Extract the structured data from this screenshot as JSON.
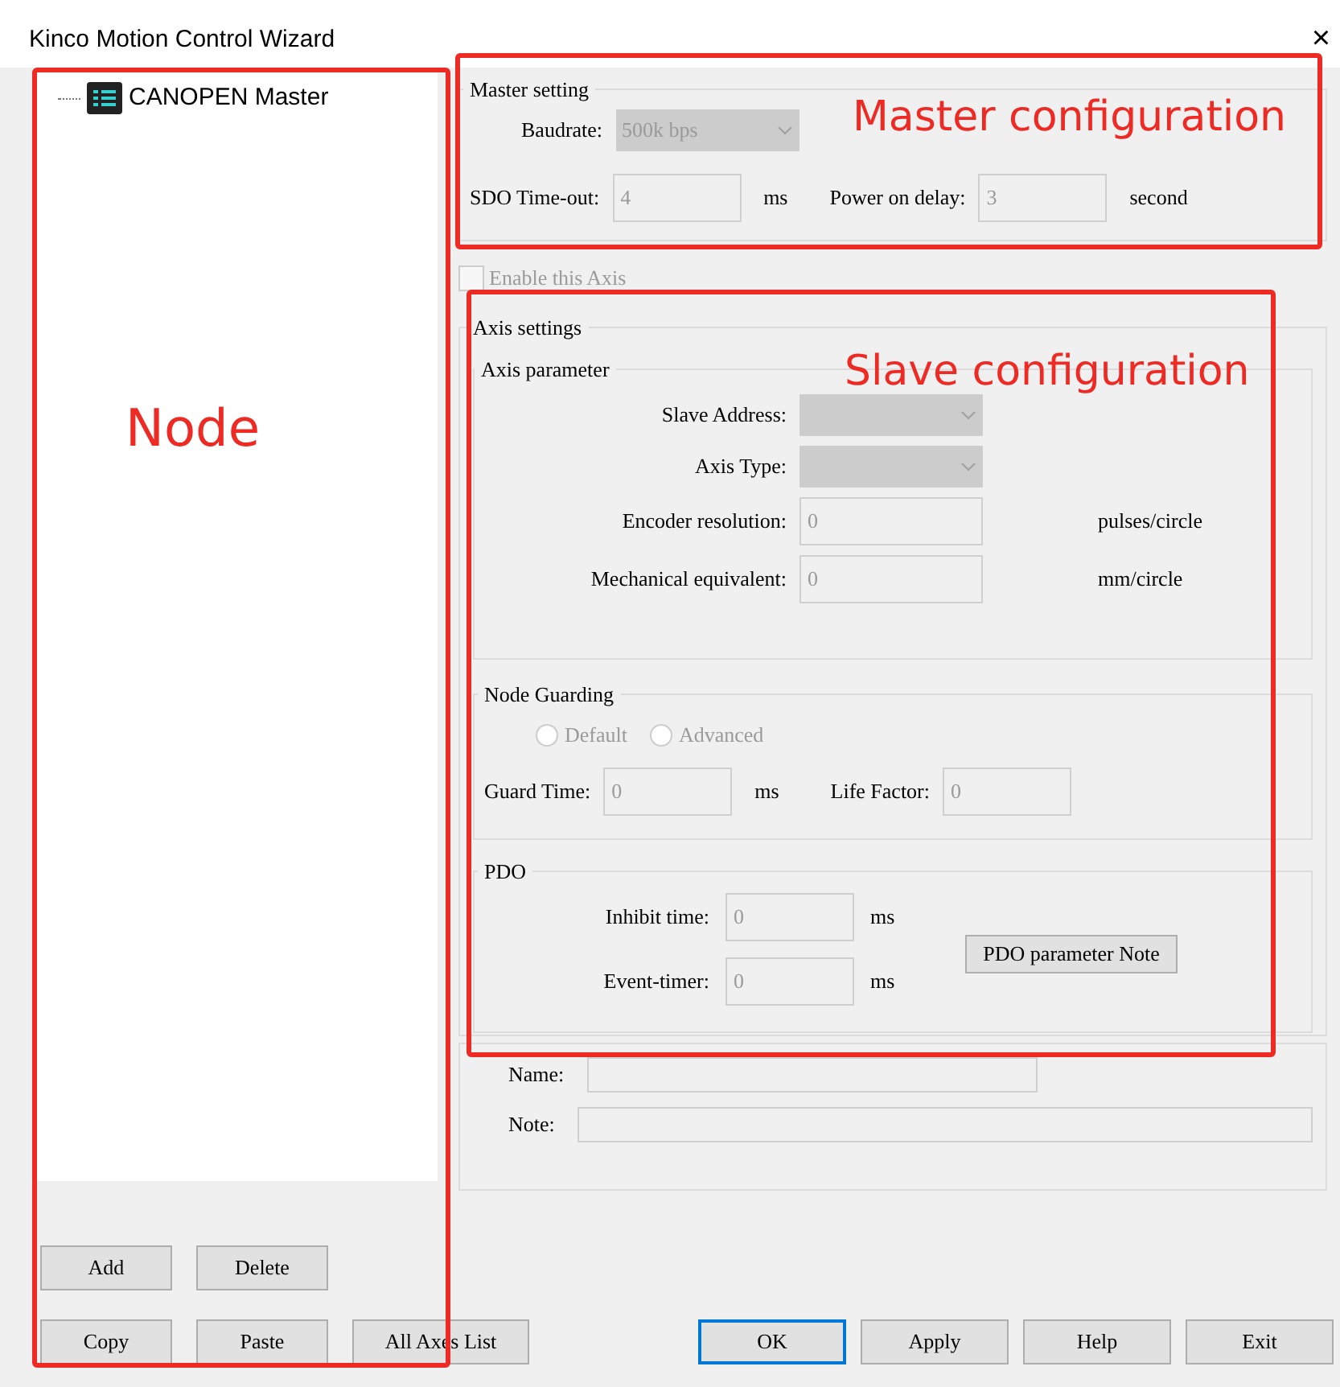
{
  "window": {
    "title": "Kinco Motion Control Wizard",
    "close": "×"
  },
  "tree": [
    {
      "label": "CANOPEN Master",
      "selected": false
    }
  ],
  "master_setting": {
    "title": "Master setting",
    "baudrate": {
      "label": "Baudrate:",
      "value": "500k bps",
      "disabled": true
    },
    "sdo_timeout": {
      "label": "SDO Time-out:",
      "value": "4",
      "unit": "ms",
      "disabled": true
    },
    "power_on_delay": {
      "label": "Power on delay:",
      "value": "3",
      "unit": "second",
      "disabled": true
    }
  },
  "enable_axis": {
    "label": "Enable this Axis",
    "checked": false,
    "disabled": true
  },
  "axis_settings": {
    "title": "Axis  settings",
    "axis_parameter": {
      "title": "Axis parameter",
      "rows": [
        {
          "label": "Slave Address:",
          "kind": "select",
          "disabled": true
        },
        {
          "label": "Axis Type:",
          "kind": "select",
          "disabled": true
        },
        {
          "label": "Encoder resolution:",
          "kind": "input",
          "value": "0",
          "unit": "pulses/circle",
          "disabled": true
        },
        {
          "label": "Mechanical equivalent:",
          "kind": "input",
          "value": "0",
          "unit": "mm/circle",
          "disabled": true
        }
      ]
    },
    "node_guarding": {
      "title": "Node Guarding",
      "options": [
        {
          "label": "Default",
          "selected": false,
          "disabled": true
        },
        {
          "label": "Advanced",
          "selected": false,
          "disabled": true
        }
      ],
      "guard_time": {
        "label": "Guard Time:",
        "value": "0",
        "unit": "ms",
        "disabled": true
      },
      "life_factor": {
        "label": "Life Factor:",
        "value": "0",
        "disabled": true
      }
    },
    "pdo": {
      "title": "PDO",
      "inhibit_time": {
        "label": "Inhibit time:",
        "value": "0",
        "unit": "ms",
        "disabled": true
      },
      "event_timer": {
        "label": "Event-timer:",
        "value": "0",
        "unit": "ms",
        "disabled": true
      },
      "note_button": "PDO parameter Note"
    }
  },
  "name_field": {
    "label": "Name:",
    "disabled": true
  },
  "note_field": {
    "label": "Note:",
    "disabled": true
  },
  "node_buttons": [
    "Add",
    "Delete",
    "Copy",
    "Paste",
    "All Axes List"
  ],
  "dialog_buttons": [
    {
      "label": "OK",
      "default": true
    },
    {
      "label": "Apply",
      "default": false
    },
    {
      "label": "Help",
      "default": false
    },
    {
      "label": "Exit",
      "default": false
    }
  ],
  "annotations": [
    {
      "label": "Node"
    },
    {
      "label": "Master configuration"
    },
    {
      "label": "Slave configuration"
    }
  ]
}
